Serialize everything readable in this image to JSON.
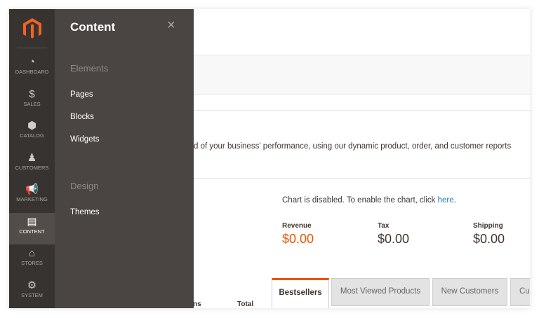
{
  "nav": {
    "items": [
      {
        "label": "DASHBOARD",
        "icon": "dashboard-icon",
        "glyph": "◔"
      },
      {
        "label": "SALES",
        "icon": "dollar-icon",
        "glyph": "$"
      },
      {
        "label": "CATALOG",
        "icon": "box-icon",
        "glyph": "⬢"
      },
      {
        "label": "CUSTOMERS",
        "icon": "person-icon",
        "glyph": "♟"
      },
      {
        "label": "MARKETING",
        "icon": "megaphone-icon",
        "glyph": "📢"
      },
      {
        "label": "CONTENT",
        "icon": "layout-icon",
        "glyph": "▤"
      },
      {
        "label": "STORES",
        "icon": "storefront-icon",
        "glyph": "⌂"
      },
      {
        "label": "SYSTEM",
        "icon": "gear-icon",
        "glyph": "⚙"
      }
    ],
    "active": "CONTENT"
  },
  "flyout": {
    "title": "Content",
    "close": "×",
    "sections": [
      {
        "title": "Elements",
        "links": [
          "Pages",
          "Blocks",
          "Widgets"
        ]
      },
      {
        "title": "Design",
        "links": [
          "Themes"
        ]
      }
    ]
  },
  "main": {
    "description": "d of your business' performance, using our dynamic product, order, and customer reports",
    "chart_msg": "Chart is disabled. To enable the chart, click ",
    "chart_link": "here",
    "chart_end": ".",
    "metrics": [
      {
        "label": "Revenue",
        "value": "$0.00"
      },
      {
        "label": "Tax",
        "value": "$0.00"
      },
      {
        "label": "Shipping",
        "value": "$0.00"
      }
    ],
    "tabs": [
      "Bestsellers",
      "Most Viewed Products",
      "New Customers",
      "Cus"
    ],
    "table_headers": [
      "ns",
      "Total"
    ]
  },
  "colors": {
    "accent": "#eb5202",
    "nav": "#373330",
    "flyout": "#4a4542",
    "link": "#1979c3"
  }
}
